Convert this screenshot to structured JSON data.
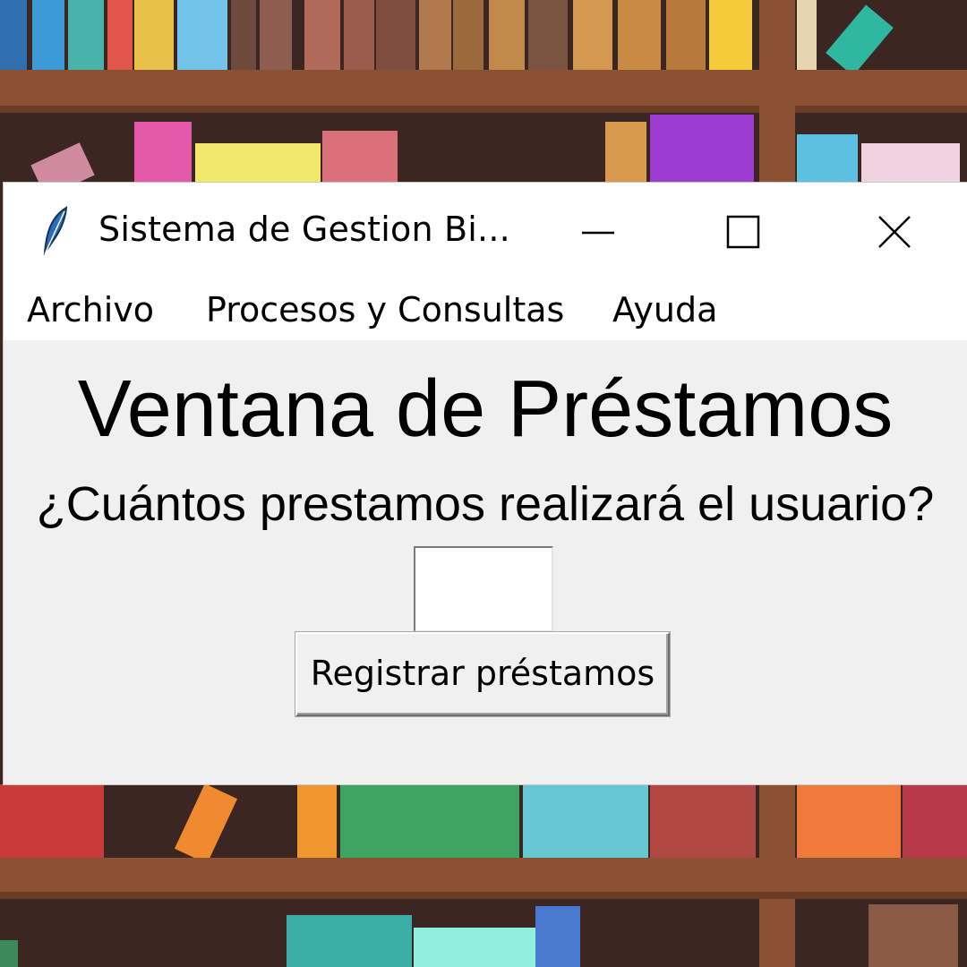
{
  "window": {
    "title": "Sistema de Gestion Bi...",
    "icon": "feather-icon",
    "controls": [
      "minimize-icon",
      "maximize-icon",
      "close-icon"
    ]
  },
  "menu": {
    "items": [
      "Archivo",
      "Procesos y Consultas",
      "Ayuda"
    ]
  },
  "content": {
    "heading": "Ventana de Préstamos",
    "question": "¿Cuántos prestamos realizará el usuario?",
    "entry_value": "",
    "button_label": "Registrar préstamos"
  },
  "colors": {
    "window_bg": "#f0f0f0",
    "titlebar_bg": "#ffffff",
    "shelf_wood": "#8a5232",
    "shelf_back": "#3b2622"
  }
}
